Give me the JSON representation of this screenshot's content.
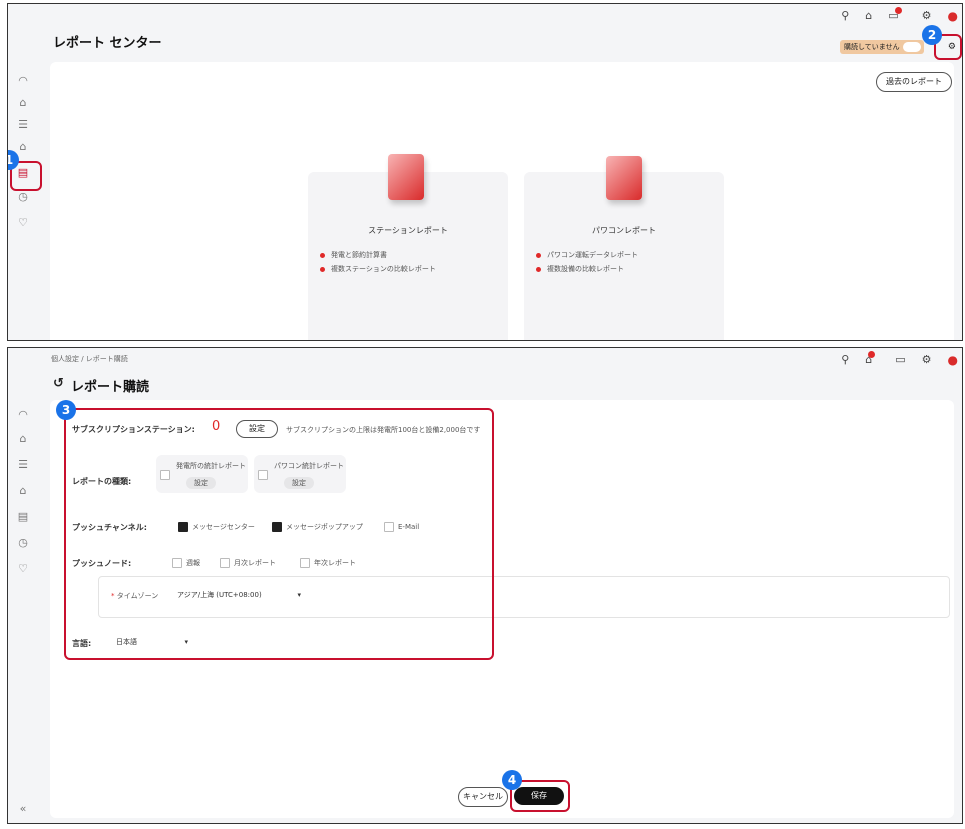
{
  "panel1": {
    "title": "レポート センター",
    "unsubscribed_label": "購読していません",
    "history_button": "過去のレポート",
    "cards": [
      {
        "title": "ステーションレポート",
        "items": [
          "発電と節約計算書",
          "複数ステーションの比較レポート"
        ]
      },
      {
        "title": "パワコンレポート",
        "items": [
          "パワコン運転データレポート",
          "複数設備の比較レポート"
        ]
      }
    ],
    "badges": {
      "one": "1",
      "two": "2"
    }
  },
  "panel2": {
    "breadcrumb": "個人設定 / レポート購読",
    "back_icon": "back-arrow",
    "title": "レポート購読",
    "subscription_label": "サブスクリプションステーション:",
    "subscription_count": "0",
    "settings_button": "設定",
    "subscription_hint": "サブスクリプションの上限は発電所100台と設備2,000台です",
    "report_type_label": "レポートの種類:",
    "report_types": [
      {
        "label": "発電所の統計レポート",
        "button": "設定"
      },
      {
        "label": "パワコン統計レポート",
        "button": "設定"
      }
    ],
    "push_channel_label": "プッシュチャンネル:",
    "channels": [
      {
        "label": "メッセージセンター",
        "checked": true
      },
      {
        "label": "メッセージポップアップ",
        "checked": true
      },
      {
        "label": "E-Mail",
        "checked": false
      }
    ],
    "push_mode_label": "プッシュノード:",
    "modes": [
      "週報",
      "月次レポート",
      "年次レポート"
    ],
    "timezone_label": "タイムゾーン",
    "timezone_value": "アジア/上海 (UTC+08:00)",
    "language_label": "言語:",
    "language_value": "日本語",
    "cancel_button": "キャンセル",
    "save_button": "保存",
    "badges": {
      "three": "3",
      "four": "4"
    }
  },
  "colors": {
    "accent": "#c8102e",
    "callout": "#1a73e8",
    "bullet": "#e02929"
  }
}
